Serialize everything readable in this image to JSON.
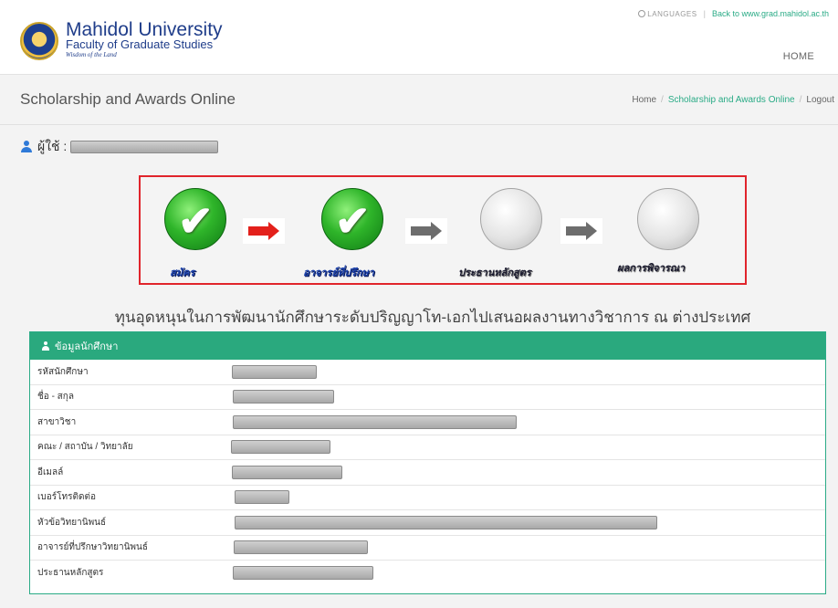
{
  "header": {
    "university": "Mahidol University",
    "faculty": "Faculty of Graduate Studies",
    "tagline": "Wisdom of the Land",
    "languages_label": "LANGUAGES",
    "back_link": "Back to www.grad.mahidol.ac.th",
    "nav_home": "HOME"
  },
  "page": {
    "title": "Scholarship and Awards Online",
    "breadcrumb": [
      "Home",
      "Scholarship and Awards Online",
      "Logout"
    ]
  },
  "user": {
    "label": "ผู้ใช้ :"
  },
  "steps": {
    "items": [
      {
        "label": "สมัคร",
        "status": "done",
        "icon": "check-circle-icon"
      },
      {
        "label": "อาจารย์ที่ปรึกษา",
        "status": "done",
        "icon": "check-circle-icon"
      },
      {
        "label": "ประธานหลักสูตร",
        "status": "pending",
        "icon": "pending-circle-icon"
      },
      {
        "label": "ผลการพิจารณา",
        "status": "pending",
        "icon": "pending-circle-icon"
      }
    ],
    "arrow_colors": [
      "#e3201b",
      "#6d6d6d",
      "#6d6d6d"
    ],
    "highlight_color": "#e0242b"
  },
  "scholarship_title": "ทุนอุดหนุนในการพัฒนานักศึกษาระดับปริญญาโท-เอกไปเสนอผลงานทางวิชาการ ณ ต่างประเทศ",
  "student_panel": {
    "title": "ข้อมูลนักศึกษา",
    "accent": "#2aa97e",
    "fields": [
      "รหัสนักศึกษา",
      "ชื่อ - สกุล",
      "สาขาวิชา",
      "คณะ / สถาบัน / วิทยาลัย",
      "อีเมลล์",
      "เบอร์โทรติดต่อ",
      "หัวข้อวิทยานิพนธ์",
      "อาจารย์ที่ปรึกษาวิทยานิพนธ์",
      "ประธานหลักสูตร"
    ]
  }
}
